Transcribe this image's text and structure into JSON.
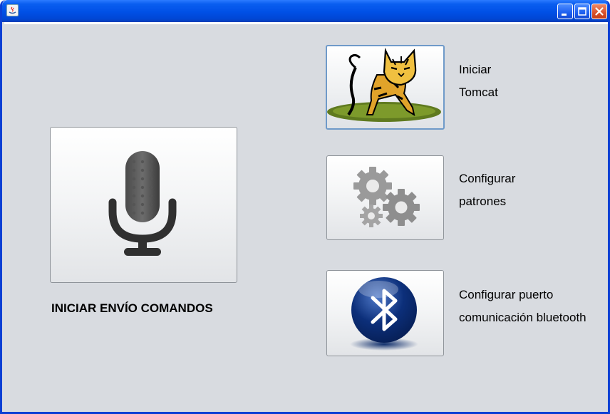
{
  "window": {
    "title": "",
    "controls": [
      "minimize",
      "maximize",
      "close"
    ]
  },
  "main_action": {
    "label": "INICIAR ENVÍO COMANDOS",
    "icon": "microphone-icon"
  },
  "actions": [
    {
      "icon": "tomcat-icon",
      "line1": "Iniciar",
      "line2": "Tomcat"
    },
    {
      "icon": "gears-icon",
      "line1": "Configurar",
      "line2": "patrones"
    },
    {
      "icon": "bluetooth-icon",
      "line1": "Configurar puerto",
      "line2": "comunicación bluetooth"
    }
  ]
}
